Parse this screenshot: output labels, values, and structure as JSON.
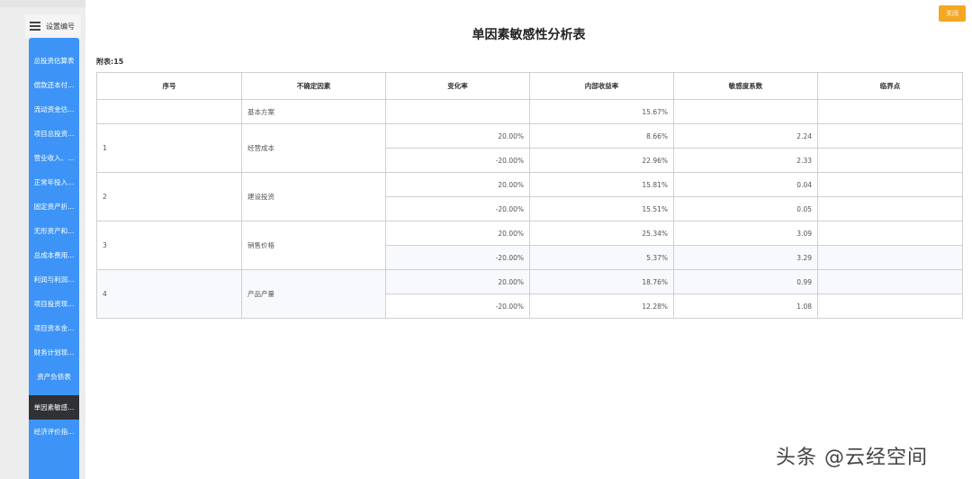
{
  "toolbar": {
    "settings_label": "设置编号",
    "close_label": "关闭"
  },
  "sidebar": {
    "items": [
      {
        "label": "总投资估算表",
        "active": false
      },
      {
        "label": "偿款还本付...",
        "active": false
      },
      {
        "label": "流动资金估...",
        "active": false
      },
      {
        "label": "项目总投资...",
        "active": false
      },
      {
        "label": "营业收入、...",
        "active": false
      },
      {
        "label": "正常年投入...",
        "active": false
      },
      {
        "label": "固定资产折...",
        "active": false
      },
      {
        "label": "无形资产和...",
        "active": false
      },
      {
        "label": "总成本费用...",
        "active": false
      },
      {
        "label": "利润与利润...",
        "active": false
      },
      {
        "label": "项目投资现...",
        "active": false
      },
      {
        "label": "项目资本金...",
        "active": false
      },
      {
        "label": "财务计划现...",
        "active": false
      },
      {
        "label": "资产负债表",
        "active": false
      },
      {
        "label": "单因素敏感...",
        "active": true
      },
      {
        "label": "经济评价指...",
        "active": false
      }
    ]
  },
  "main": {
    "title": "单因素敏感性分析表",
    "caption": "附表:15",
    "columns": [
      "序号",
      "不确定因素",
      "变化率",
      "内部收益率",
      "敏感度系数",
      "临界点"
    ],
    "base": {
      "factor": "基本方案",
      "irr": "15.67%"
    },
    "groups": [
      {
        "no": "1",
        "factor": "经营成本",
        "rows": [
          {
            "change": "20.00%",
            "irr": "8.66%",
            "coef": "2.24"
          },
          {
            "change": "-20.00%",
            "irr": "22.96%",
            "coef": "2.33"
          }
        ]
      },
      {
        "no": "2",
        "factor": "建设投资",
        "rows": [
          {
            "change": "20.00%",
            "irr": "15.81%",
            "coef": "0.04"
          },
          {
            "change": "-20.00%",
            "irr": "15.51%",
            "coef": "0.05"
          }
        ]
      },
      {
        "no": "3",
        "factor": "销售价格",
        "rows": [
          {
            "change": "20.00%",
            "irr": "25.34%",
            "coef": "3.09"
          },
          {
            "change": "-20.00%",
            "irr": "5.37%",
            "coef": "3.29"
          }
        ]
      },
      {
        "no": "4",
        "factor": "产品产量",
        "rows": [
          {
            "change": "20.00%",
            "irr": "18.76%",
            "coef": "0.99"
          },
          {
            "change": "-20.00%",
            "irr": "12.28%",
            "coef": "1.08"
          }
        ]
      }
    ]
  },
  "watermark": "头条 @云经空间"
}
